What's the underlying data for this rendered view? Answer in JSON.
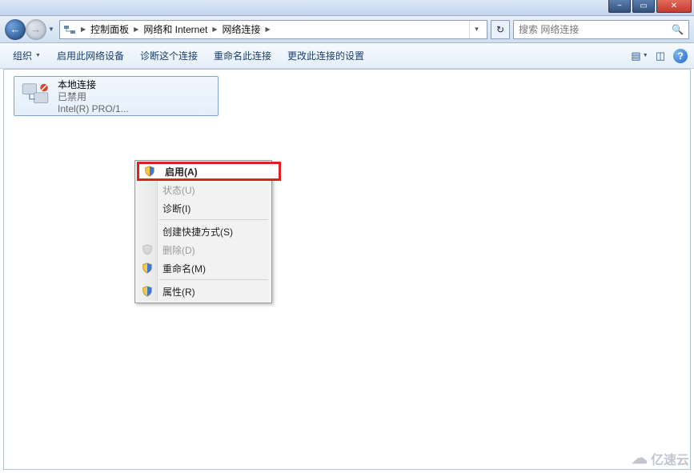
{
  "titlebar": {
    "minimize": "−",
    "maximize": "▭",
    "close": "✕"
  },
  "nav": {
    "back": "←",
    "forward": "→"
  },
  "breadcrumb": {
    "seg1": "控制面板",
    "seg2": "网络和 Internet",
    "seg3": "网络连接"
  },
  "search": {
    "placeholder": "搜索 网络连接"
  },
  "toolbar": {
    "organize": "组织",
    "enable_device": "启用此网络设备",
    "diagnose": "诊断这个连接",
    "rename": "重命名此连接",
    "change_settings": "更改此连接的设置"
  },
  "connection": {
    "title": "本地连接",
    "status": "已禁用",
    "adapter": "Intel(R) PRO/1..."
  },
  "context_menu": {
    "enable": "启用(A)",
    "status": "状态(U)",
    "diagnose": "诊断(I)",
    "create_shortcut": "创建快捷方式(S)",
    "delete": "删除(D)",
    "rename": "重命名(M)",
    "properties": "属性(R)"
  },
  "watermark": "亿速云"
}
